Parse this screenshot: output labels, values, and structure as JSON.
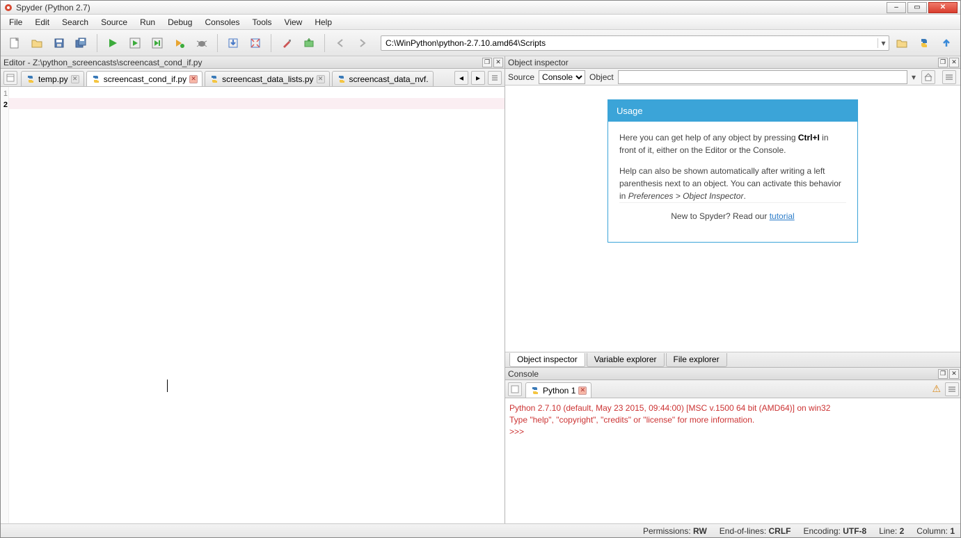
{
  "title": "Spyder (Python 2.7)",
  "menu": [
    "File",
    "Edit",
    "Search",
    "Source",
    "Run",
    "Debug",
    "Consoles",
    "Tools",
    "View",
    "Help"
  ],
  "path": "C:\\WinPython\\python-2.7.10.amd64\\Scripts",
  "editor": {
    "pane_title": "Editor - Z:\\python_screencasts\\screencast_cond_if.py",
    "tabs": [
      {
        "label": "temp.py",
        "active": false,
        "closeStyle": "grey"
      },
      {
        "label": "screencast_cond_if.py",
        "active": true,
        "closeStyle": "red"
      },
      {
        "label": "screencast_data_lists.py",
        "active": false,
        "closeStyle": "grey"
      },
      {
        "label": "screencast_data_nvf.",
        "active": false,
        "closeStyle": "none"
      }
    ],
    "lines": [
      "1",
      "2"
    ],
    "current_line": 2
  },
  "inspector": {
    "pane_title": "Object inspector",
    "source_label": "Source",
    "source_value": "Console",
    "object_label": "Object",
    "object_value": "",
    "usage_title": "Usage",
    "usage_p1_a": "Here you can get help of any object by pressing ",
    "usage_p1_b": "Ctrl+I",
    "usage_p1_c": " in front of it, either on the Editor or the Console.",
    "usage_p2_a": "Help can also be shown automatically after writing a left parenthesis next to an object. You can activate this behavior in ",
    "usage_p2_b": "Preferences > Object Inspector",
    "usage_p2_c": ".",
    "usage_foot_a": "New to Spyder? Read our ",
    "usage_foot_link": "tutorial",
    "bottom_tabs": [
      "Object inspector",
      "Variable explorer",
      "File explorer"
    ]
  },
  "console": {
    "pane_title": "Console",
    "tab_label": "Python 1",
    "line1": "Python 2.7.10 (default, May 23 2015, 09:44:00) [MSC v.1500 64 bit (AMD64)] on win32",
    "line2": "Type \"help\", \"copyright\", \"credits\" or \"license\" for more information.",
    "prompt": ">>> "
  },
  "status": {
    "perm_label": "Permissions:",
    "perm_val": "RW",
    "eol_label": "End-of-lines:",
    "eol_val": "CRLF",
    "enc_label": "Encoding:",
    "enc_val": "UTF-8",
    "line_label": "Line:",
    "line_val": "2",
    "col_label": "Column:",
    "col_val": "1"
  }
}
